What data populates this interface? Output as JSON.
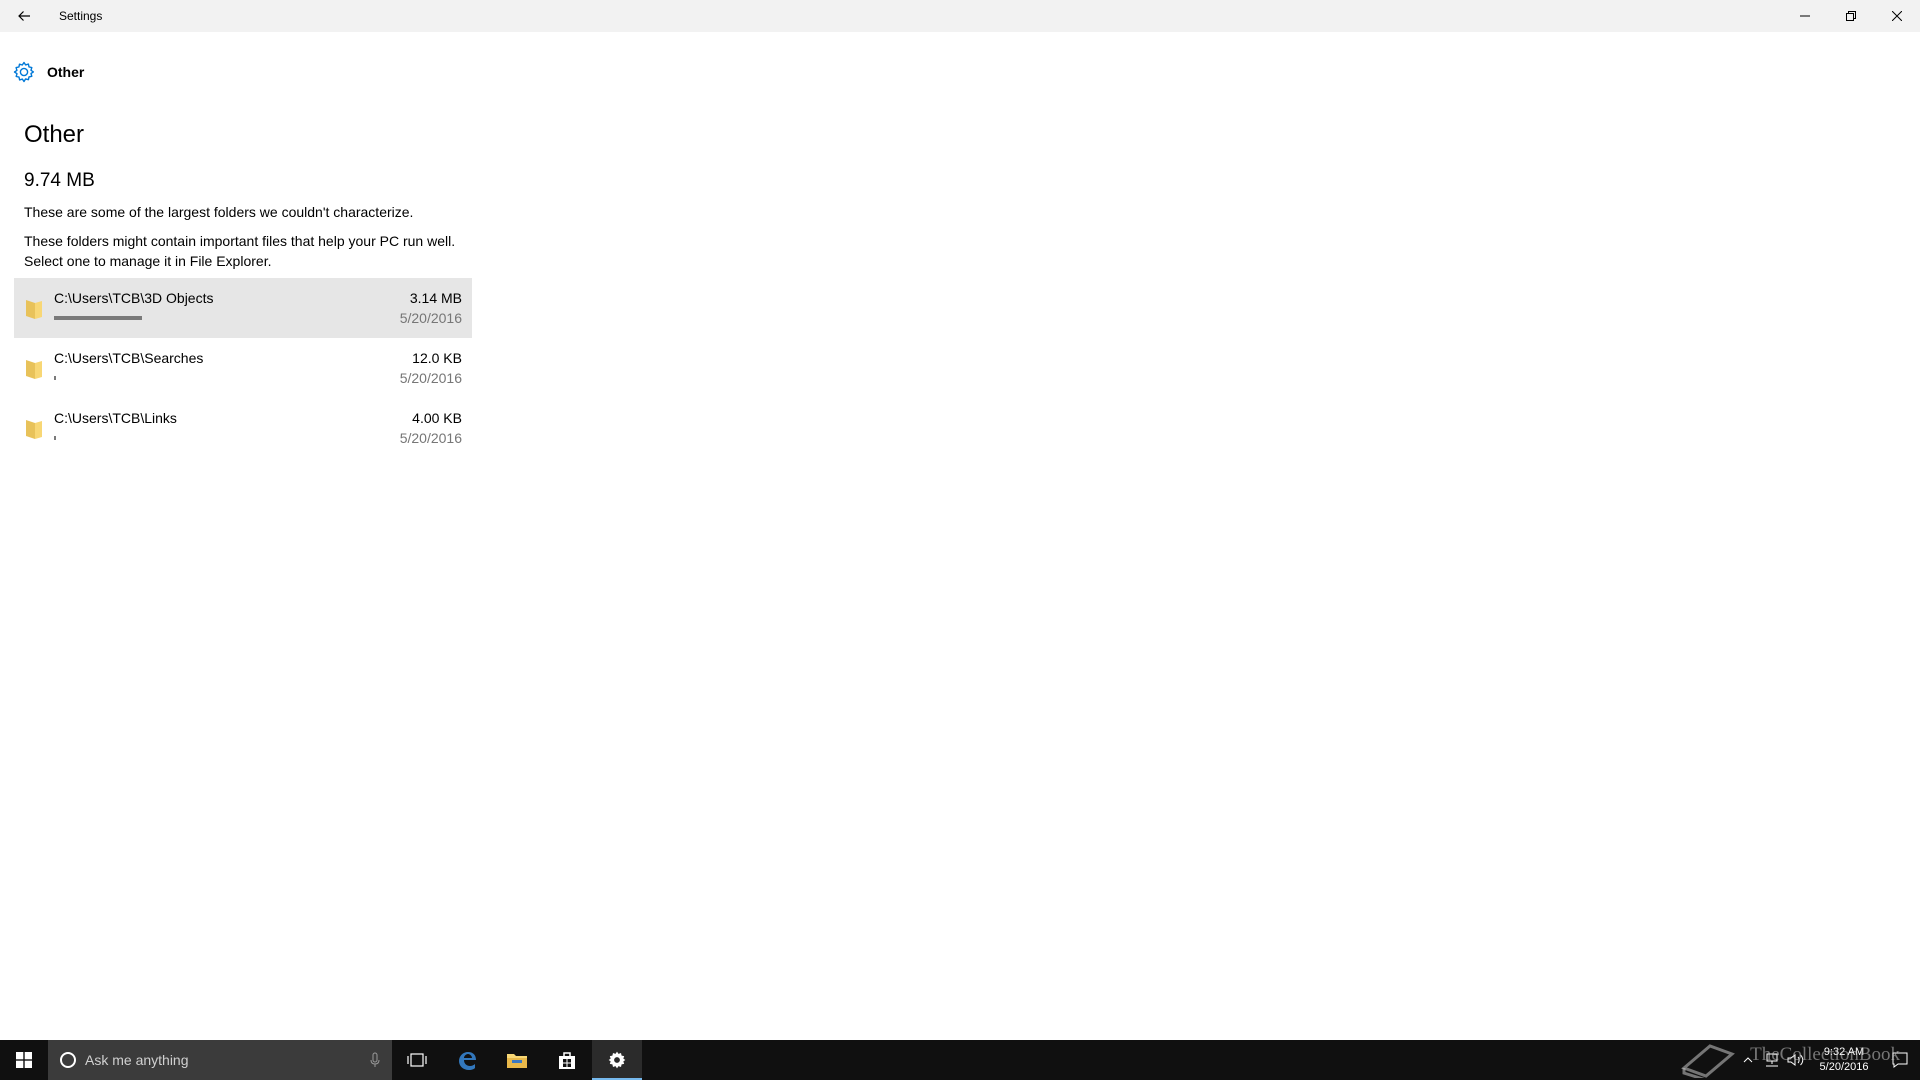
{
  "window": {
    "title": "Settings"
  },
  "page": {
    "header_label": "Other",
    "heading": "Other",
    "total_size": "9.74 MB",
    "description_1": "These are some of the largest folders we couldn't characterize.",
    "description_2": "These folders might contain important files that help your PC run well. Select one to manage it in File Explorer."
  },
  "folders": [
    {
      "path": "C:\\Users\\TCB\\3D Objects",
      "size": "3.14 MB",
      "date": "5/20/2016",
      "usage_fraction": 0.35,
      "selected": true
    },
    {
      "path": "C:\\Users\\TCB\\Searches",
      "size": "12.0 KB",
      "date": "5/20/2016",
      "usage_fraction": 0.004,
      "selected": false
    },
    {
      "path": "C:\\Users\\TCB\\Links",
      "size": "4.00 KB",
      "date": "5/20/2016",
      "usage_fraction": 0.002,
      "selected": false
    }
  ],
  "taskbar": {
    "search_placeholder": "Ask me anything",
    "pinned": [
      "task-view-icon",
      "edge-icon",
      "file-explorer-icon",
      "store-icon",
      "settings-icon"
    ],
    "active_app": "settings-icon"
  },
  "tray": {
    "time": "9:32 AM",
    "date": "5/20/2016",
    "watermark": "TheCollectionBook"
  },
  "colors": {
    "accent": "#0078d7",
    "folder_yellow": "#f8d775",
    "taskbar_bg": "#101010",
    "search_bg": "#3b3b3b",
    "selected_row_bg": "#e6e6e6"
  }
}
